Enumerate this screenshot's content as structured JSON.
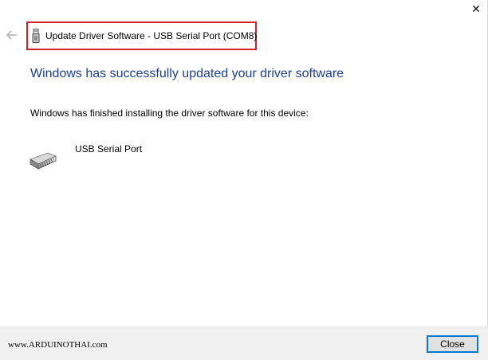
{
  "window": {
    "close_glyph": "✕",
    "back_icon": "back-arrow-icon"
  },
  "titlebar": {
    "title": "Update Driver Software - USB Serial Port (COM8)",
    "icon": "usb-device-icon",
    "highlight_color": "#d41f2c"
  },
  "main": {
    "heading": "Windows has successfully updated your driver software",
    "heading_color": "#1c3f94",
    "info": "Windows has finished installing the driver software for this device:",
    "device": {
      "icon": "serial-port-icon",
      "name": "USB Serial Port"
    }
  },
  "footer": {
    "watermark": "www.ARDUINOTHAI.com",
    "close_label": "Close",
    "focus_color": "#0078d7"
  }
}
